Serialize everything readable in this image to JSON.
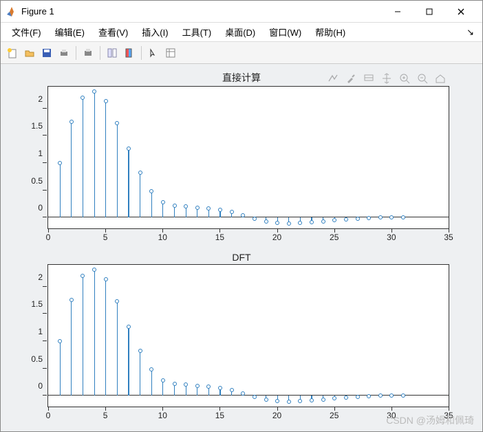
{
  "window": {
    "title": "Figure 1"
  },
  "menu": {
    "file": "文件(F)",
    "edit": "编辑(E)",
    "view": "查看(V)",
    "insert": "插入(I)",
    "tools": "工具(T)",
    "desktop": "桌面(D)",
    "window": "窗口(W)",
    "help": "帮助(H)"
  },
  "watermark": "CSDN @汤姆和佩琦",
  "chart_data": [
    {
      "type": "stem",
      "title": "直接计算",
      "xlabel": "",
      "ylabel": "",
      "xlim": [
        0,
        35
      ],
      "ylim": [
        -0.2,
        2.4
      ],
      "xticks": [
        0,
        5,
        10,
        15,
        20,
        25,
        30,
        35
      ],
      "yticks": [
        0,
        0.5,
        1,
        1.5,
        2
      ],
      "x": [
        1,
        2,
        3,
        4,
        5,
        6,
        7,
        8,
        9,
        10,
        11,
        12,
        13,
        14,
        15,
        16,
        17,
        18,
        19,
        20,
        21,
        22,
        23,
        24,
        25,
        26,
        27,
        28,
        29,
        30,
        31
      ],
      "values": [
        1.0,
        1.76,
        2.2,
        2.31,
        2.13,
        1.73,
        1.26,
        0.82,
        0.48,
        0.28,
        0.22,
        0.2,
        0.18,
        0.16,
        0.14,
        0.1,
        0.04,
        -0.02,
        -0.07,
        -0.1,
        -0.11,
        -0.1,
        -0.09,
        -0.07,
        -0.05,
        -0.03,
        -0.02,
        -0.01,
        0.0,
        0.0,
        0.0
      ]
    },
    {
      "type": "stem",
      "title": "DFT",
      "xlabel": "",
      "ylabel": "",
      "xlim": [
        0,
        35
      ],
      "ylim": [
        -0.2,
        2.4
      ],
      "xticks": [
        0,
        5,
        10,
        15,
        20,
        25,
        30,
        35
      ],
      "yticks": [
        0,
        0.5,
        1,
        1.5,
        2
      ],
      "x": [
        1,
        2,
        3,
        4,
        5,
        6,
        7,
        8,
        9,
        10,
        11,
        12,
        13,
        14,
        15,
        16,
        17,
        18,
        19,
        20,
        21,
        22,
        23,
        24,
        25,
        26,
        27,
        28,
        29,
        30,
        31
      ],
      "values": [
        1.0,
        1.76,
        2.2,
        2.31,
        2.13,
        1.73,
        1.26,
        0.82,
        0.48,
        0.28,
        0.22,
        0.2,
        0.18,
        0.16,
        0.14,
        0.1,
        0.04,
        -0.02,
        -0.07,
        -0.1,
        -0.11,
        -0.1,
        -0.09,
        -0.07,
        -0.05,
        -0.03,
        -0.02,
        -0.01,
        0.0,
        0.0,
        0.0
      ]
    }
  ]
}
